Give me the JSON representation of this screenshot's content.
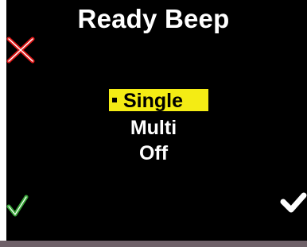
{
  "screen": {
    "title": "Ready Beep"
  },
  "menu": {
    "items": [
      {
        "label": "Single",
        "selected": true
      },
      {
        "label": "Multi",
        "selected": false
      },
      {
        "label": "Off",
        "selected": false
      }
    ]
  },
  "icons": {
    "cancel": "close-icon",
    "confirm_left": "checkmark-icon",
    "confirm_right": "checkmark-icon"
  },
  "colors": {
    "background": "#000000",
    "highlight": "#f4ec14",
    "text": "#ffffff",
    "cancel": "#e01818",
    "confirm_left": "#3aa83a",
    "confirm_right": "#ffffff"
  }
}
